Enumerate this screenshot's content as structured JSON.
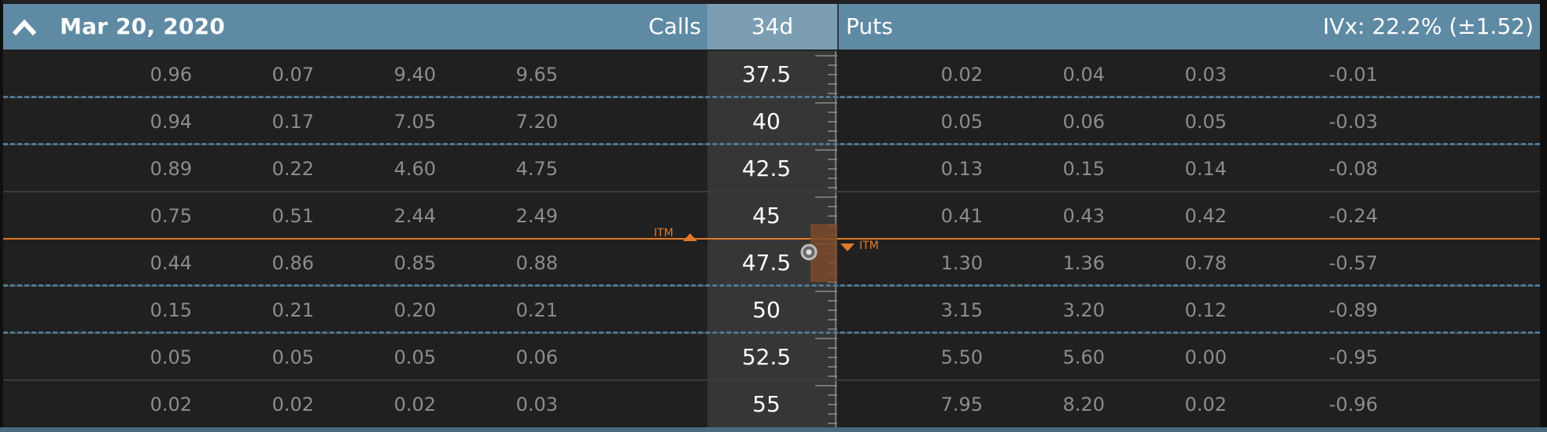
{
  "header": {
    "expiration": "Mar 20, 2020",
    "calls_label": "Calls",
    "days_to_expiry": "34d",
    "puts_label": "Puts",
    "ivx": "IVx: 22.2% (±1.52)"
  },
  "itm_label": "ITM",
  "rows": [
    {
      "calls": [
        "0.96",
        "0.07",
        "9.40",
        "9.65"
      ],
      "strike": "37.5",
      "puts": [
        "0.02",
        "0.04",
        "0.03",
        "-0.01"
      ]
    },
    {
      "calls": [
        "0.94",
        "0.17",
        "7.05",
        "7.20"
      ],
      "strike": "40",
      "puts": [
        "0.05",
        "0.06",
        "0.05",
        "-0.03"
      ]
    },
    {
      "calls": [
        "0.89",
        "0.22",
        "4.60",
        "4.75"
      ],
      "strike": "42.5",
      "puts": [
        "0.13",
        "0.15",
        "0.14",
        "-0.08"
      ]
    },
    {
      "calls": [
        "0.75",
        "0.51",
        "2.44",
        "2.49"
      ],
      "strike": "45",
      "puts": [
        "0.41",
        "0.43",
        "0.42",
        "-0.24"
      ]
    },
    {
      "calls": [
        "0.44",
        "0.86",
        "0.85",
        "0.88"
      ],
      "strike": "47.5",
      "puts": [
        "1.30",
        "1.36",
        "0.78",
        "-0.57"
      ]
    },
    {
      "calls": [
        "0.15",
        "0.21",
        "0.20",
        "0.21"
      ],
      "strike": "50",
      "puts": [
        "3.15",
        "3.20",
        "0.12",
        "-0.89"
      ]
    },
    {
      "calls": [
        "0.05",
        "0.05",
        "0.05",
        "0.06"
      ],
      "strike": "52.5",
      "puts": [
        "5.50",
        "5.60",
        "0.00",
        "-0.95"
      ]
    },
    {
      "calls": [
        "0.02",
        "0.02",
        "0.02",
        "0.03"
      ],
      "strike": "55",
      "puts": [
        "7.95",
        "8.20",
        "0.02",
        "-0.96"
      ]
    }
  ],
  "colors": {
    "header_bg": "#5f8aa3",
    "itm_accent": "#e07a2a",
    "std_dev_dash": "#4f7894"
  },
  "icons": {
    "collapse": "chevron-up-icon",
    "underlying": "target-circle-icon"
  }
}
